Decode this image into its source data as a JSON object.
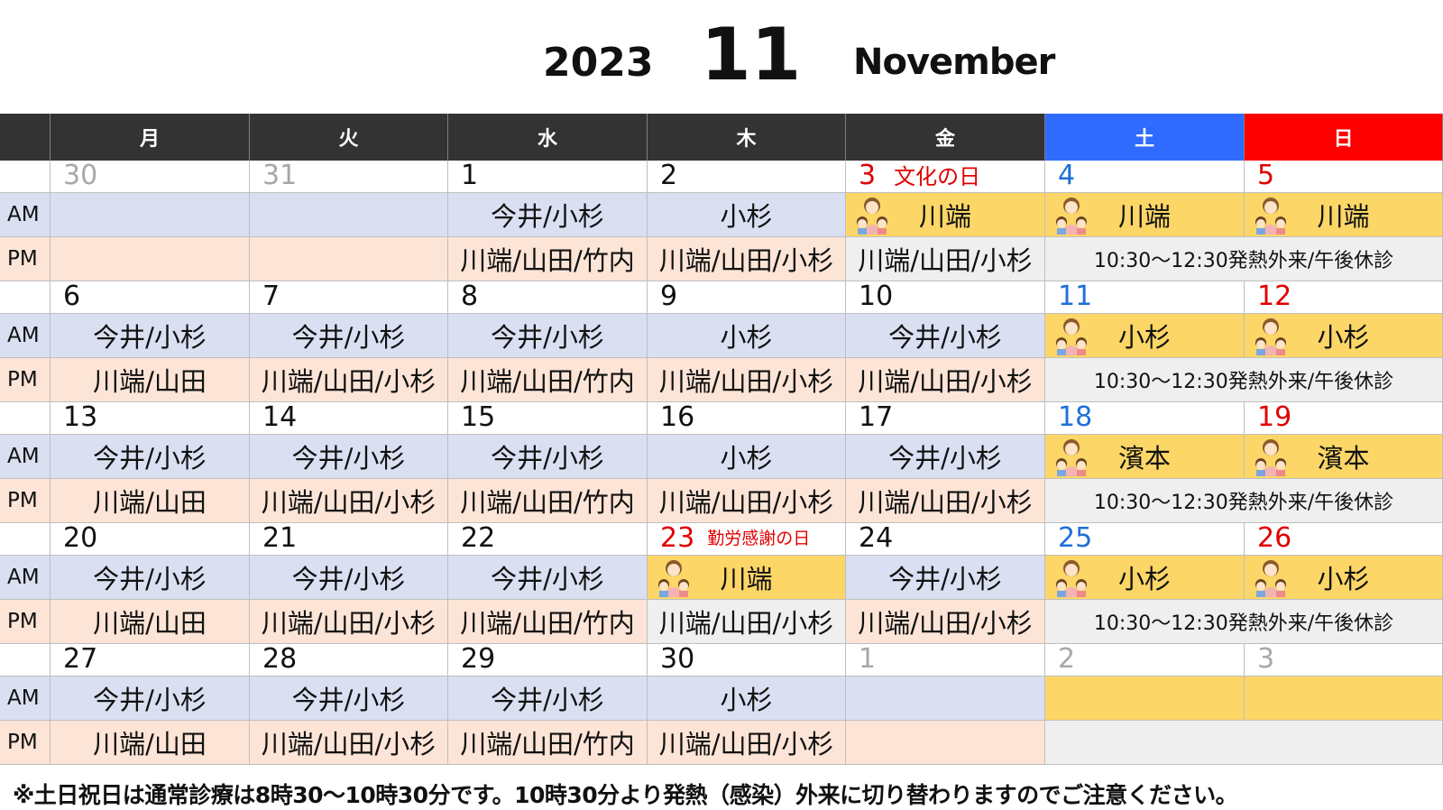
{
  "header": {
    "year": "2023",
    "month": "11",
    "month_name": "November"
  },
  "weekdays": [
    "月",
    "火",
    "水",
    "木",
    "金",
    "土",
    "日"
  ],
  "row_labels": {
    "am": "AM",
    "pm": "PM"
  },
  "colors": {
    "header_dark": "#333333",
    "saturday": "#2f6bff",
    "sunday": "#ff0000",
    "am_bg": "#dae0f2",
    "pm_bg": "#fce4d6",
    "weekend_bg": "#fcd666",
    "holiday_red": "#e00000",
    "saturday_blue": "#1e6fd8",
    "muted": "#a8a8a8"
  },
  "weekend_pm_note": "10:30～12:30発熱外来/午後休診",
  "weeks": [
    {
      "days": [
        {
          "num": "30",
          "muted": true,
          "am": "",
          "pm": ""
        },
        {
          "num": "31",
          "muted": true,
          "am": "",
          "pm": ""
        },
        {
          "num": "1",
          "am": "今井/小杉",
          "pm": "川端/山田/竹内"
        },
        {
          "num": "2",
          "am": "小杉",
          "pm": "川端/山田/小杉"
        },
        {
          "num": "3",
          "holiday": "文化の日",
          "am": "川端",
          "pm": "川端/山田/小杉"
        },
        {
          "num": "4",
          "am": "川端"
        },
        {
          "num": "5",
          "am": "川端"
        }
      ]
    },
    {
      "days": [
        {
          "num": "6",
          "am": "今井/小杉",
          "pm": "川端/山田"
        },
        {
          "num": "7",
          "am": "今井/小杉",
          "pm": "川端/山田/小杉"
        },
        {
          "num": "8",
          "am": "今井/小杉",
          "pm": "川端/山田/竹内"
        },
        {
          "num": "9",
          "am": "小杉",
          "pm": "川端/山田/小杉"
        },
        {
          "num": "10",
          "am": "今井/小杉",
          "pm": "川端/山田/小杉"
        },
        {
          "num": "11",
          "am": "小杉"
        },
        {
          "num": "12",
          "am": "小杉"
        }
      ]
    },
    {
      "days": [
        {
          "num": "13",
          "am": "今井/小杉",
          "pm": "川端/山田"
        },
        {
          "num": "14",
          "am": "今井/小杉",
          "pm": "川端/山田/小杉"
        },
        {
          "num": "15",
          "am": "今井/小杉",
          "pm": "川端/山田/竹内"
        },
        {
          "num": "16",
          "am": "小杉",
          "pm": "川端/山田/小杉"
        },
        {
          "num": "17",
          "am": "今井/小杉",
          "pm": "川端/山田/小杉"
        },
        {
          "num": "18",
          "am": "濱本"
        },
        {
          "num": "19",
          "am": "濱本"
        }
      ]
    },
    {
      "days": [
        {
          "num": "20",
          "am": "今井/小杉",
          "pm": "川端/山田"
        },
        {
          "num": "21",
          "am": "今井/小杉",
          "pm": "川端/山田/小杉"
        },
        {
          "num": "22",
          "am": "今井/小杉",
          "pm": "川端/山田/竹内"
        },
        {
          "num": "23",
          "holiday": "勤労感謝の日",
          "am": "川端",
          "pm": "川端/山田/小杉"
        },
        {
          "num": "24",
          "am": "今井/小杉",
          "pm": "川端/山田/小杉"
        },
        {
          "num": "25",
          "am": "小杉"
        },
        {
          "num": "26",
          "am": "小杉"
        }
      ]
    },
    {
      "days": [
        {
          "num": "27",
          "am": "今井/小杉",
          "pm": "川端/山田"
        },
        {
          "num": "28",
          "am": "今井/小杉",
          "pm": "川端/山田/小杉"
        },
        {
          "num": "29",
          "am": "今井/小杉",
          "pm": "川端/山田/竹内"
        },
        {
          "num": "30",
          "am": "小杉",
          "pm": "川端/山田/小杉"
        },
        {
          "num": "1",
          "muted": true,
          "am": "",
          "pm": ""
        },
        {
          "num": "2",
          "muted": true,
          "am": ""
        },
        {
          "num": "3",
          "muted": true,
          "am": ""
        }
      ]
    }
  ],
  "footer_note": "※土日祝日は通常診療は8時30～10時30分です。10時30分より発熱（感染）外来に切り替わりますのでご注意ください。"
}
